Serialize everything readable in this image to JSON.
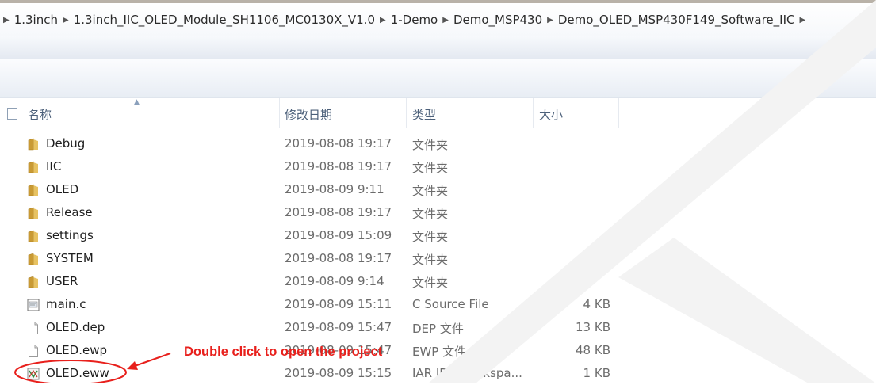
{
  "breadcrumb": [
    "1.3inch",
    "1.3inch_IIC_OLED_Module_SH1106_MC0130X_V1.0",
    "1-Demo",
    "Demo_MSP430",
    "Demo_OLED_MSP430F149_Software_IIC"
  ],
  "columns": {
    "name": "名称",
    "date": "修改日期",
    "type": "类型",
    "size": "大小"
  },
  "files": [
    {
      "name": "Debug",
      "date": "2019-08-08 19:17",
      "type": "文件夹",
      "size": "",
      "icon": "folder-icon"
    },
    {
      "name": "IIC",
      "date": "2019-08-08 19:17",
      "type": "文件夹",
      "size": "",
      "icon": "folder-icon"
    },
    {
      "name": "OLED",
      "date": "2019-08-09 9:11",
      "type": "文件夹",
      "size": "",
      "icon": "folder-icon"
    },
    {
      "name": "Release",
      "date": "2019-08-08 19:17",
      "type": "文件夹",
      "size": "",
      "icon": "folder-icon"
    },
    {
      "name": "settings",
      "date": "2019-08-09 15:09",
      "type": "文件夹",
      "size": "",
      "icon": "folder-icon"
    },
    {
      "name": "SYSTEM",
      "date": "2019-08-08 19:17",
      "type": "文件夹",
      "size": "",
      "icon": "folder-icon"
    },
    {
      "name": "USER",
      "date": "2019-08-09 9:14",
      "type": "文件夹",
      "size": "",
      "icon": "folder-icon"
    },
    {
      "name": "main.c",
      "date": "2019-08-09 15:11",
      "type": "C Source File",
      "size": "4 KB",
      "icon": "c-source-file-icon"
    },
    {
      "name": "OLED.dep",
      "date": "2019-08-09 15:47",
      "type": "DEP 文件",
      "size": "13 KB",
      "icon": "file-icon"
    },
    {
      "name": "OLED.ewp",
      "date": "2019-08-09 15:47",
      "type": "EWP 文件",
      "size": "48 KB",
      "icon": "file-icon"
    },
    {
      "name": "OLED.eww",
      "date": "2019-08-09 15:15",
      "type": "IAR IDE Workspa...",
      "size": "1 KB",
      "icon": "iar-workspace-icon"
    }
  ],
  "annotation": {
    "text": "Double click to open the project",
    "color": "#e8201c"
  }
}
